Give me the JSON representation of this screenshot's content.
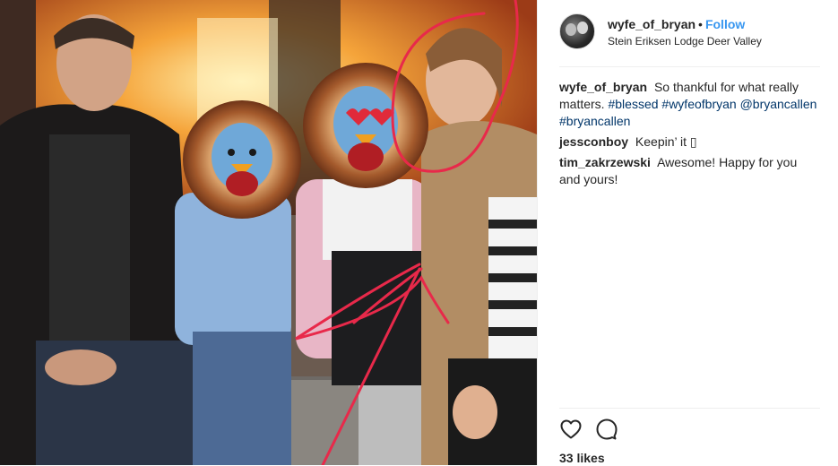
{
  "post": {
    "username": "wyfe_of_bryan",
    "separator": "•",
    "follow_label": "Follow",
    "location": "Stein Eriksen Lodge Deer Valley",
    "caption": {
      "user": "wyfe_of_bryan",
      "text": "So thankful for what really matters.",
      "tags": [
        "#blessed",
        "#wyfeofbryan",
        "@bryancallen",
        "#bryancallen"
      ]
    },
    "comments": [
      {
        "user": "jessconboy",
        "text": "Keepin’ it ▯"
      },
      {
        "user": "tim_zakrzewski",
        "text": "Awesome! Happy for you and yours!"
      }
    ],
    "likes": "33 likes"
  },
  "icons": {
    "like": "heart-icon",
    "comment": "comment-bubble-icon"
  },
  "colors": {
    "follow": "#3897f0",
    "hashtag": "#003569",
    "annotation": "#e8294a",
    "border": "#efefef"
  }
}
